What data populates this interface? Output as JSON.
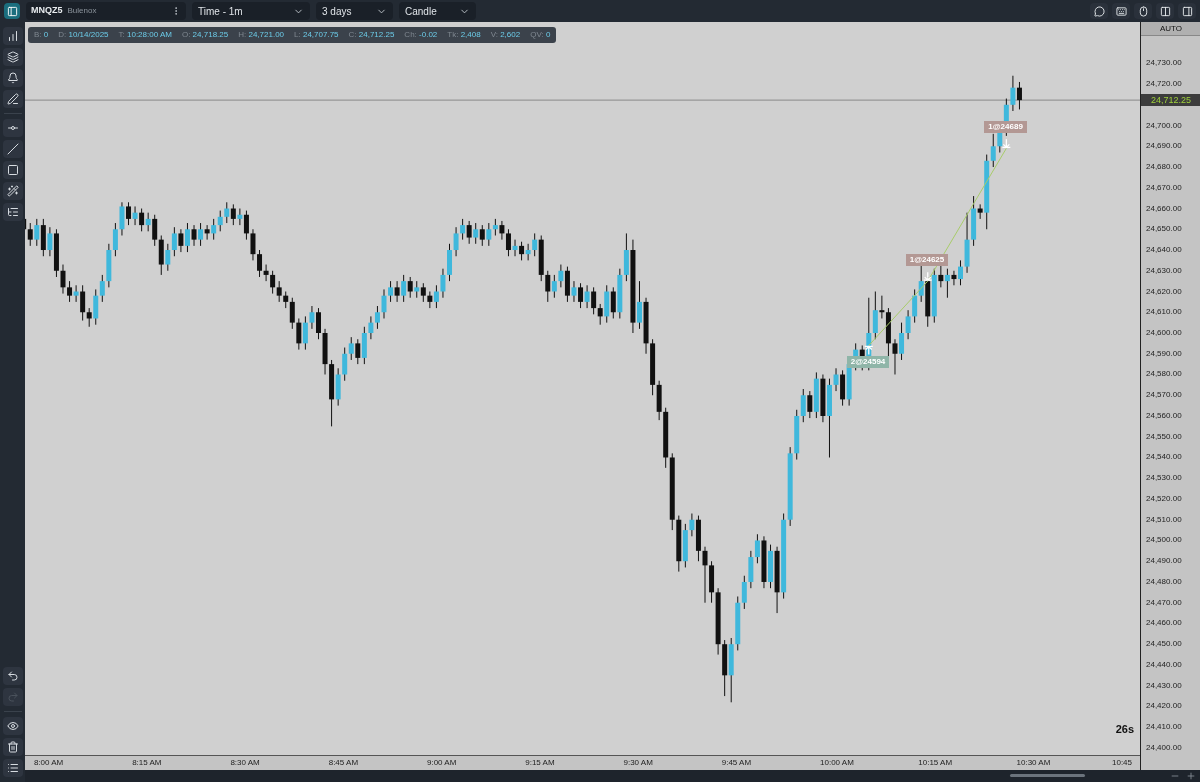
{
  "toolbar": {
    "symbol": "MNQZ5",
    "account": "Bulenox",
    "dropdowns": [
      "Time - 1m",
      "3 days",
      "Candle"
    ]
  },
  "left_toolbar": {
    "redo": {
      "disabled": true
    }
  },
  "info_bar": [
    {
      "label": "B:",
      "value": "0"
    },
    {
      "label": "D:",
      "value": "10/14/2025"
    },
    {
      "label": "T:",
      "value": "10:28:00 AM"
    },
    {
      "label": "O:",
      "value": "24,718.25"
    },
    {
      "label": "H:",
      "value": "24,721.00"
    },
    {
      "label": "L:",
      "value": "24,707.75"
    },
    {
      "label": "C:",
      "value": "24,712.25"
    },
    {
      "label": "Ch:",
      "value": "-0.02"
    },
    {
      "label": "Tk:",
      "value": "2,408"
    },
    {
      "label": "V:",
      "value": "2,602"
    },
    {
      "label": "QV:",
      "value": "0"
    }
  ],
  "chart": {
    "kind": "picture",
    "trades": [
      {
        "label": "2@24594",
        "kind": "buy"
      },
      {
        "label": "1@24625",
        "kind": "sell"
      },
      {
        "label": "1@24689",
        "kind": "sell"
      }
    ],
    "timer": "26s"
  },
  "price_axis": {
    "mode_button": "AUTO",
    "labels": [
      "24,730.00",
      "24,720.00",
      "24,700.00",
      "24,690.00",
      "24,680.00",
      "24,670.00",
      "24,660.00",
      "24,650.00",
      "24,640.00",
      "24,630.00",
      "24,620.00",
      "24,610.00",
      "24,600.00",
      "24,590.00",
      "24,580.00",
      "24,570.00",
      "24,560.00",
      "24,550.00",
      "24,540.00",
      "24,530.00",
      "24,520.00",
      "24,510.00",
      "24,500.00",
      "24,490.00",
      "24,480.00",
      "24,470.00",
      "24,460.00",
      "24,450.00",
      "24,440.00",
      "24,430.00",
      "24,420.00",
      "24,410.00",
      "24,400.00"
    ],
    "last_price": "24,712.25"
  },
  "time_axis": {
    "labels": [
      "8:00 AM",
      "8:15 AM",
      "8:30 AM",
      "8:45 AM",
      "9:00 AM",
      "9:15 AM",
      "9:30 AM",
      "9:45 AM",
      "10:00 AM",
      "10:15 AM",
      "10:30 AM",
      "10:45"
    ]
  }
}
